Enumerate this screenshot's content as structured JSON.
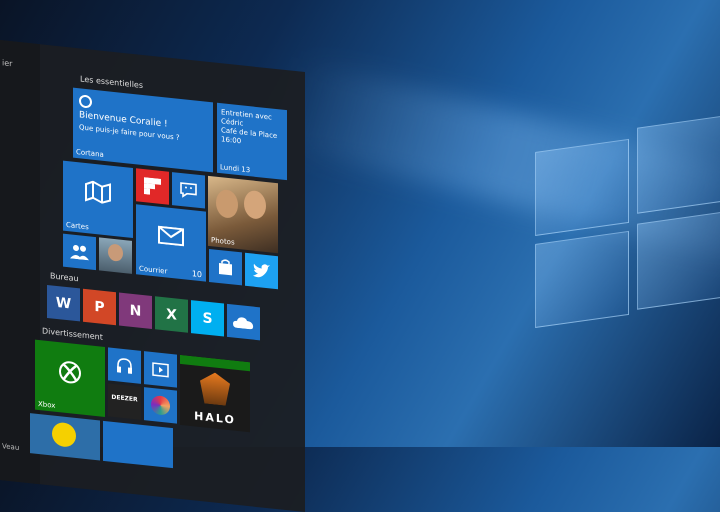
{
  "start_menu": {
    "left_top": "ier",
    "left_bottom": "Veau",
    "sections": {
      "essentials": "Les essentielles",
      "bureau": "Bureau",
      "divertissement": "Divertissement"
    },
    "cortana": {
      "title": "Bienvenue Coralie !",
      "subtitle": "Que puis-je faire pour vous ?",
      "label": "Cortana"
    },
    "calendar": {
      "line1": "Entretien avec",
      "line2": "Cédric",
      "line3": "Café de la Place",
      "line4": "16:00",
      "day": "Lundi 13"
    },
    "tiles": {
      "cartes": "Cartes",
      "photos": "Photos",
      "courrier": "Courrier",
      "courrier_count": "10",
      "xbox": "Xbox",
      "deezer": "DEEZER",
      "halo": "HALO"
    }
  },
  "colors": {
    "accent": "#1f73c8",
    "flipboard": "#e12828",
    "word": "#2b579a",
    "powerpoint": "#d24726",
    "onenote": "#80397b",
    "excel": "#217346",
    "skype": "#00aff0",
    "xbox": "#107c10"
  }
}
